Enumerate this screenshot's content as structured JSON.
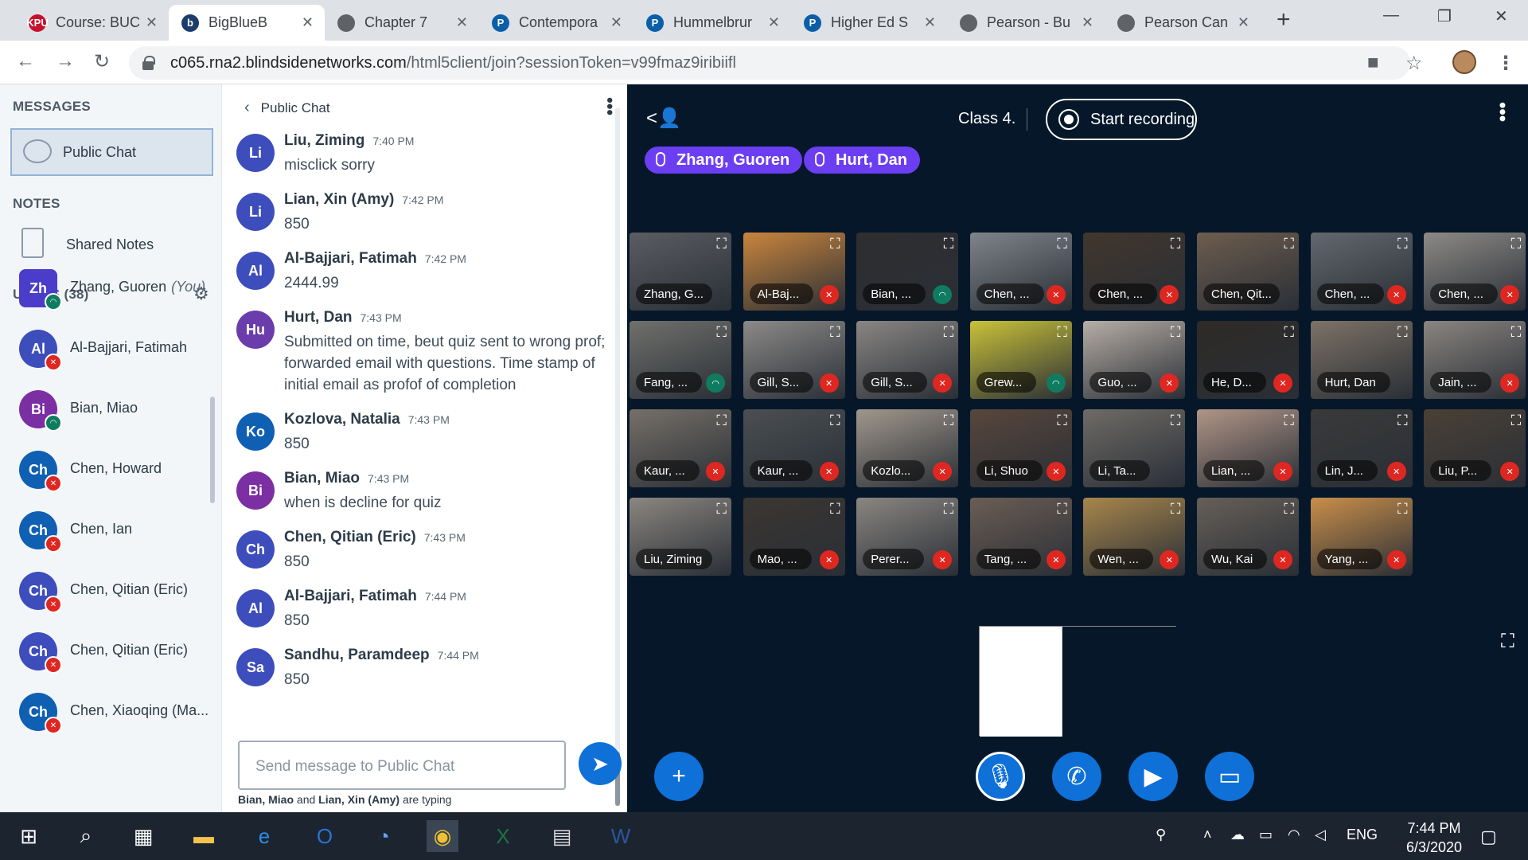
{
  "browser": {
    "tabs": [
      {
        "title": "Course: BUC",
        "fav_text": "KPU",
        "fav_color": "#c8102e",
        "active": false
      },
      {
        "title": "BigBlueB",
        "fav_text": "b",
        "fav_color": "#1c3c6b",
        "active": true
      },
      {
        "title": "Chapter 7",
        "fav_text": "",
        "fav_color": "#5f6368",
        "active": false
      },
      {
        "title": "Contempora",
        "fav_text": "P",
        "fav_color": "#0a5fa8",
        "active": false
      },
      {
        "title": "Hummelbrur",
        "fav_text": "P",
        "fav_color": "#0a5fa8",
        "active": false
      },
      {
        "title": "Higher Ed S",
        "fav_text": "P",
        "fav_color": "#0a5fa8",
        "active": false
      },
      {
        "title": "Pearson - Bu",
        "fav_text": "",
        "fav_color": "#5f6368",
        "active": false
      },
      {
        "title": "Pearson Can",
        "fav_text": "",
        "fav_color": "#5f6368",
        "active": false
      }
    ],
    "url_host": "c065.rna2.blindsidenetworks.com",
    "url_path": "/html5client/join?sessionToken=v99fmaz9iribiifl"
  },
  "sidebar": {
    "messages_title": "MESSAGES",
    "public_chat_label": "Public Chat",
    "notes_title": "NOTES",
    "shared_notes_label": "Shared Notes",
    "users_title": "USERS (38)",
    "users": [
      {
        "initials": "Zh",
        "name": "Zhang, Guoren",
        "suffix": "(You)",
        "color": "#4a3dc9",
        "status": "listen",
        "presenter": true
      },
      {
        "initials": "Al",
        "name": "Al-Bajjari, Fatimah",
        "suffix": "",
        "color": "#3d4dbc",
        "status": "muted",
        "presenter": false
      },
      {
        "initials": "Bi",
        "name": "Bian, Miao",
        "suffix": "",
        "color": "#7b2fa3",
        "status": "listen",
        "presenter": false
      },
      {
        "initials": "Ch",
        "name": "Chen, Howard",
        "suffix": "",
        "color": "#0f5fb3",
        "status": "muted",
        "presenter": false
      },
      {
        "initials": "Ch",
        "name": "Chen, Ian",
        "suffix": "",
        "color": "#0f5fb3",
        "status": "muted",
        "presenter": false
      },
      {
        "initials": "Ch",
        "name": "Chen, Qitian (Eric)",
        "suffix": "",
        "color": "#3d4dbc",
        "status": "muted",
        "presenter": false
      },
      {
        "initials": "Ch",
        "name": "Chen, Qitian (Eric)",
        "suffix": "",
        "color": "#3d4dbc",
        "status": "muted",
        "presenter": false
      },
      {
        "initials": "Ch",
        "name": "Chen, Xiaoqing (Ma...",
        "suffix": "",
        "color": "#0f5fb3",
        "status": "muted",
        "presenter": false
      }
    ]
  },
  "chat": {
    "title": "Public Chat",
    "messages": [
      {
        "initials": "Li",
        "color": "#3d4dbc",
        "name": "Liu, Ziming",
        "time": "7:40 PM",
        "text": "misclick sorry"
      },
      {
        "initials": "Li",
        "color": "#3d4dbc",
        "name": "Lian, Xin (Amy)",
        "time": "7:42 PM",
        "text": "850"
      },
      {
        "initials": "Al",
        "color": "#3d4dbc",
        "name": "Al-Bajjari, Fatimah",
        "time": "7:42 PM",
        "text": "2444.99"
      },
      {
        "initials": "Hu",
        "color": "#6b3cab",
        "name": "Hurt, Dan",
        "time": "7:43 PM",
        "text": "Submitted on time, beut quiz sent to wrong prof; forwarded email with questions. Time stamp of initial email as profof of completion"
      },
      {
        "initials": "Ko",
        "color": "#0f5fb3",
        "name": "Kozlova, Natalia",
        "time": "7:43 PM",
        "text": "850"
      },
      {
        "initials": "Bi",
        "color": "#7b2fa3",
        "name": "Bian, Miao",
        "time": "7:43 PM",
        "text": "when is decline for quiz"
      },
      {
        "initials": "Ch",
        "color": "#3d4dbc",
        "name": "Chen, Qitian (Eric)",
        "time": "7:43 PM",
        "text": "850"
      },
      {
        "initials": "Al",
        "color": "#3d4dbc",
        "name": "Al-Bajjari, Fatimah",
        "time": "7:44 PM",
        "text": "850"
      },
      {
        "initials": "Sa",
        "color": "#3d4dbc",
        "name": "Sandhu, Paramdeep",
        "time": "7:44 PM",
        "text": "850"
      }
    ],
    "input_placeholder": "Send message to Public Chat",
    "typing_user1": "Bian, Miao",
    "typing_and": "and",
    "typing_user2": "Lian, Xin (Amy)",
    "typing_suffix": "are typing"
  },
  "stage": {
    "meeting_name": "Class 4.",
    "record_label": "Start recording",
    "talkers": [
      "Zhang, Guoren",
      "Hurt, Dan"
    ],
    "videos": [
      {
        "label": "Zhang, G...",
        "status": "none",
        "tint": "#5a5d62"
      },
      {
        "label": "Al-Baj...",
        "status": "muted",
        "tint": "#c9853d"
      },
      {
        "label": "Bian, ...",
        "status": "listen",
        "tint": "#2e2e30"
      },
      {
        "label": "Chen, ...",
        "status": "muted",
        "tint": "#7e848a"
      },
      {
        "label": "Chen, ...",
        "status": "muted",
        "tint": "#41362c"
      },
      {
        "label": "Chen, Qit...",
        "status": "none",
        "tint": "#6d5d4e"
      },
      {
        "label": "Chen, ...",
        "status": "muted",
        "tint": "#62686e"
      },
      {
        "label": "Chen, ...",
        "status": "muted",
        "tint": "#8d8a86"
      },
      {
        "label": "Fang, ...",
        "status": "listen",
        "tint": "#70706c"
      },
      {
        "label": "Gill, S...",
        "status": "muted",
        "tint": "#8c8a88"
      },
      {
        "label": "Gill, S...",
        "status": "muted",
        "tint": "#898683"
      },
      {
        "label": "Grew...",
        "status": "listen",
        "tint": "#c9c238"
      },
      {
        "label": "Guo, ...",
        "status": "muted",
        "tint": "#b7aea6"
      },
      {
        "label": "He, D...",
        "status": "muted",
        "tint": "#2e2a26"
      },
      {
        "label": "Hurt, Dan",
        "status": "none",
        "tint": "#7d7266"
      },
      {
        "label": "Jain, ...",
        "status": "muted",
        "tint": "#8a8580"
      },
      {
        "label": "Kaur, ...",
        "status": "muted",
        "tint": "#767068"
      },
      {
        "label": "Kaur, ...",
        "status": "muted",
        "tint": "#4b4f52"
      },
      {
        "label": "Kozlo...",
        "status": "muted",
        "tint": "#a0978c"
      },
      {
        "label": "Li, Shuo",
        "status": "muted",
        "tint": "#58463c"
      },
      {
        "label": "Li, Ta...",
        "status": "none",
        "tint": "#6f6b66"
      },
      {
        "label": "Lian, ...",
        "status": "muted",
        "tint": "#b19587"
      },
      {
        "label": "Lin, J...",
        "status": "muted",
        "tint": "#3a3a3a"
      },
      {
        "label": "Liu, P...",
        "status": "muted",
        "tint": "#4a4036"
      },
      {
        "label": "Liu, Ziming",
        "status": "none",
        "tint": "#8b8680"
      },
      {
        "label": "Mao, ...",
        "status": "muted",
        "tint": "#3b3631"
      },
      {
        "label": "Perer...",
        "status": "muted",
        "tint": "#8a8681"
      },
      {
        "label": "Tang, ...",
        "status": "muted",
        "tint": "#6b5d54"
      },
      {
        "label": "Wen, ...",
        "status": "muted",
        "tint": "#a8864c"
      },
      {
        "label": "Wu, Kai",
        "status": "muted",
        "tint": "#665f58"
      },
      {
        "label": "Yang, ...",
        "status": "muted",
        "tint": "#c98e4a"
      }
    ]
  },
  "taskbar": {
    "language": "ENG",
    "time": "7:44 PM",
    "date": "6/3/2020"
  }
}
